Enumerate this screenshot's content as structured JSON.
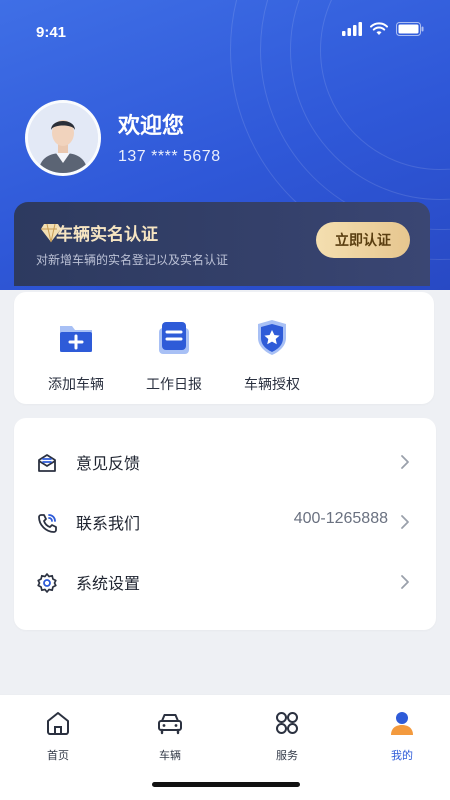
{
  "status_bar": {
    "time": "9:41"
  },
  "profile": {
    "greeting": "欢迎您",
    "phone": "137 **** 5678"
  },
  "certification": {
    "title": "车辆实名认证",
    "subtitle": "对新增车辆的实名登记以及实名认证",
    "button": "立即认证"
  },
  "shortcuts": [
    {
      "label": "添加车辆",
      "icon": "add-folder-icon"
    },
    {
      "label": "工作日报",
      "icon": "report-icon"
    },
    {
      "label": "车辆授权",
      "icon": "authorize-badge-icon"
    }
  ],
  "menu": [
    {
      "label": "意见反馈",
      "value": "",
      "icon": "feedback-icon"
    },
    {
      "label": "联系我们",
      "value": "400-1265888",
      "icon": "phone-icon"
    },
    {
      "label": "系统设置",
      "value": "",
      "icon": "settings-gear-icon"
    }
  ],
  "tabbar": [
    {
      "label": "首页",
      "icon": "home-icon"
    },
    {
      "label": "车辆",
      "icon": "car-icon"
    },
    {
      "label": "服务",
      "icon": "grid-icon"
    },
    {
      "label": "我的",
      "icon": "user-icon",
      "active": true
    }
  ],
  "colors": {
    "primary": "#2e5bd8",
    "gold": "#e6c68f",
    "card_dark": "#2d3a5f"
  }
}
